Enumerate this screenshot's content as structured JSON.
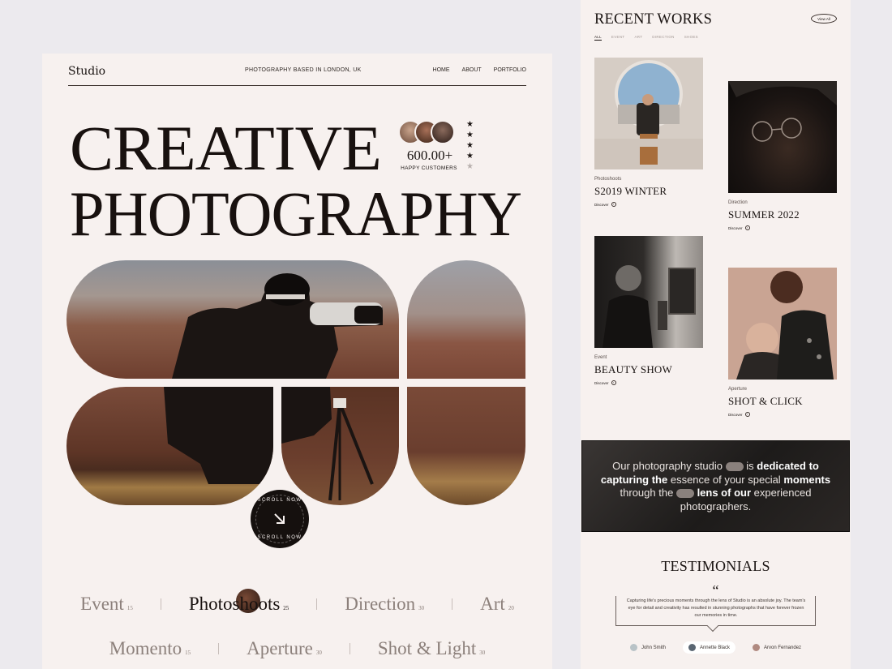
{
  "left": {
    "brand": "Studio",
    "tagline": "PHOTOGRAPHY BASED IN LONDON, UK",
    "menu": [
      "HOME",
      "ABOUT",
      "PORTFOLIO"
    ],
    "hero_line1": "CREATIVE",
    "hero_line2": "PHOTOGRAPHY",
    "customers_count": "600.00+",
    "customers_label": "HAPPY CUSTOMERS",
    "rating": {
      "filled": 4,
      "total": 5
    },
    "scroll_label": "SCROLL NOW",
    "categories_row1": [
      {
        "label": "Event",
        "count": "15"
      },
      {
        "label": "Photoshoots",
        "count": "25"
      },
      {
        "label": "Direction",
        "count": "30"
      },
      {
        "label": "Art",
        "count": "20"
      }
    ],
    "categories_row2": [
      {
        "label": "Momento",
        "count": "15"
      },
      {
        "label": "Aperture",
        "count": "30"
      },
      {
        "label": "Shot & Light",
        "count": "30"
      }
    ]
  },
  "right": {
    "title": "RECENT WORKS",
    "view_all": "View All",
    "filters": [
      "ALL",
      "EVENT",
      "ART",
      "DIRECTION",
      "SHOES"
    ],
    "cards": [
      {
        "category": "Photoshoots",
        "title": "S2019 WINTER",
        "cta": "Discover"
      },
      {
        "category": "Direction",
        "title": "SUMMER 2022",
        "cta": "Discover"
      },
      {
        "category": "Event",
        "title": "BEAUTY SHOW",
        "cta": "Discover"
      },
      {
        "category": "Aperture",
        "title": "SHOT & CLICK",
        "cta": "Discover"
      }
    ],
    "banner": {
      "p1": "Our photography studio",
      "p2": "is",
      "p3": "dedicated to capturing the",
      "p4": "essence of your special",
      "p5": "moments",
      "p6": "through the",
      "p7": "lens of our",
      "p8": "experienced photographers."
    },
    "testimonials_title": "TESTIMONIALS",
    "quote_mark": "“",
    "testimonial_text": "Capturing life's precious moments through the lens of Studio is an absolute joy. The team's eye for detail and creativity has resulted in stunning photographs that have forever frozen our memories in time.",
    "people": [
      "John Smith",
      "Annette Black",
      "Arvon Fernandez"
    ]
  },
  "colors": {
    "panel_bg": "#f7f1ef",
    "page_bg": "#eceaee",
    "ink": "#18110f",
    "muted": "#8c807b"
  }
}
